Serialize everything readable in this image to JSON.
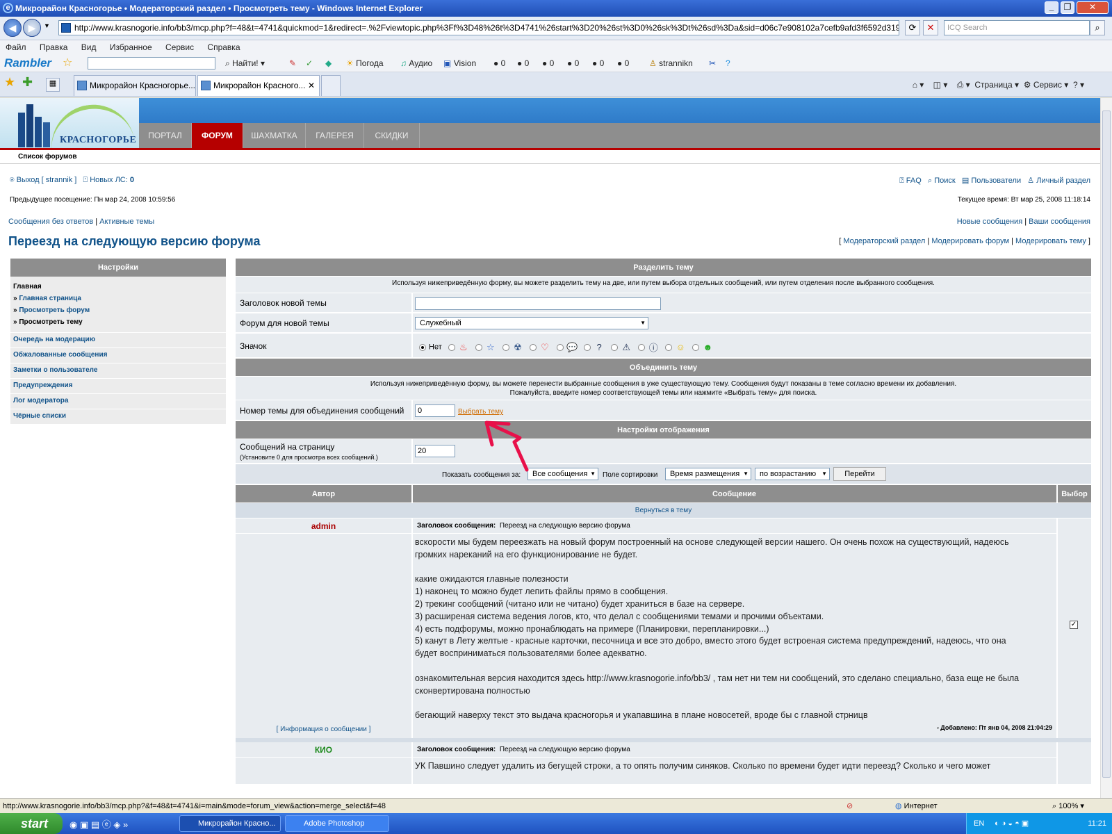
{
  "window": {
    "title": "Микрорайон Красногорье • Модераторский раздел • Просмотреть тему - Windows Internet Explorer"
  },
  "browser": {
    "address": "http://www.krasnogorie.info/bb3/mcp.php?f=48&t=4741&quickmod=1&redirect=.%2Fviewtopic.php%3Ff%3D48%26t%3D4741%26start%3D20%26st%3D0%26sk%3Dt%26sd%3Da&sid=d06c7e908102a7cefb9afd3f6592d319",
    "search_placeholder": "ICQ Search",
    "menu": [
      "Файл",
      "Правка",
      "Вид",
      "Избранное",
      "Сервис",
      "Справка"
    ],
    "rambler_logo": "Rambler",
    "rambler_find": "Найти!",
    "rambler_items": [
      "Погода",
      "Аудио",
      "Vision",
      "0",
      "0",
      "0",
      "0",
      "0",
      "0",
      "strannikn"
    ],
    "tabs": [
      "Микрорайон Красногорье...",
      "Микрорайон Красного..."
    ],
    "tools": [
      "Страница",
      "Сервис"
    ],
    "status_url": "http://www.krasnogorie.info/bb3/mcp.php?&f=48&t=4741&i=main&mode=forum_view&action=merge_select&f=48",
    "zone": "Интернет",
    "zoom": "100%"
  },
  "site": {
    "logo_text": "КРАСНОГОРЬЕ",
    "nav": [
      "ПОРТАЛ",
      "ФОРУМ",
      "ШАХМАТКА",
      "ГАЛЕРЕЯ",
      "СКИДКИ"
    ],
    "breadcrumb": "Список форумов",
    "logout": "Выход [ strannik ]",
    "new_pm_label": "Новых ЛС:",
    "new_pm_count": "0",
    "faq": "FAQ",
    "search": "Поиск",
    "members": "Пользователи",
    "ucp": "Личный раздел",
    "last_visit": "Предыдущее посещение: Пн мар 24, 2008 10:59:56",
    "current_time": "Текущее время: Вт мар 25, 2008 11:18:14",
    "unanswered": "Сообщения без ответов",
    "active": "Активные темы",
    "new_posts": "Новые сообщения",
    "your_posts": "Ваши сообщения",
    "page_title": "Переезд на следующую версию форума",
    "mod_links": [
      "Модераторский раздел",
      "Модерировать форум",
      "Модерировать тему"
    ]
  },
  "left": {
    "title": "Настройки",
    "main_label": "Главная",
    "sub": [
      "Главная страница",
      "Просмотреть форум",
      "Просмотреть тему"
    ],
    "items": [
      "Очередь на модерацию",
      "Обжалованные сообщения",
      "Заметки о пользователе",
      "Предупреждения",
      "Лог модератора",
      "Чёрные списки"
    ]
  },
  "split": {
    "title": "Разделить тему",
    "desc": "Используя нижеприведённую форму, вы можете разделить тему на две, или путем выбора отдельных сообщений, или путем отделения после выбранного сообщения.",
    "new_title_label": "Заголовок новой темы",
    "forum_label": "Форум для новой темы",
    "forum_value": "Служебный",
    "icon_label": "Значок",
    "icon_none": "Нет"
  },
  "merge": {
    "title": "Объединить тему",
    "desc1": "Используя нижеприведённую форму, вы можете перенести выбранные сообщения в уже существующую тему. Сообщения будут показаны в теме согласно времени их добавления.",
    "desc2": "Пожалуйста, введите номер соответствующей темы или нажмите «Выбрать тему» для поиска.",
    "label": "Номер темы для объединения сообщений",
    "value": "0",
    "select_link": "Выбрать тему"
  },
  "display": {
    "title": "Настройки отображения",
    "per_page_label": "Сообщений на страницу",
    "per_page_hint": "(Установите 0 для просмотра всех сообщений.)",
    "per_page_value": "20",
    "show_label": "Показать сообщения за:",
    "show_value": "Все сообщения",
    "sort_label": "Поле сортировки",
    "sort_value": "Время размещения",
    "order_value": "по возрастанию",
    "go": "Перейти"
  },
  "posts_table": {
    "col_author": "Автор",
    "col_message": "Сообщение",
    "col_select": "Выбор",
    "back": "Вернуться в тему",
    "subject_label": "Заголовок сообщения:",
    "posts": [
      {
        "author": "admin",
        "subject": "Переезд на следующую версию форума",
        "lines": [
          "вскорости мы будем переезжать на новый форум построенный на основе следующей версии нашего. Он очень похож на существующий, надеюсь громких нареканий на его функционирование не будет.",
          "",
          "какие ожидаются главные полезности",
          "1) наконец то можно будет лепить файлы прямо в сообщения.",
          "2) трекинг сообщений (читано или не читано) будет храниться в базе на сервере.",
          "3) расширеная система ведения логов, кто, что делал с сообщениями темами и прочими объектами.",
          "4) есть подфорумы, можно пронаблюдать на примере (Планировки, перепланировки...)",
          "5) канут в Лету желтые - красные карточки, песочница и все это добро, вместо этого будет встроеная система предупреждений, надеюсь, что она будет восприниматься пользователями более адекватно.",
          "",
          "ознакомительная версия находится здесь http://www.krasnogorie.info/bb3/ , там нет ни тем ни сообщений, это сделано специально, база еще не была сконвертирована полностью",
          "",
          "бегающий наверху текст это выдача красногорья и укапавшина в плане новосетей, вроде бы с главной стрницв"
        ],
        "info": "[ Информация о сообщении ]",
        "posted": "Добавлено: Пт янв 04, 2008 21:04:29"
      },
      {
        "author": "КИО",
        "subject": "Переезд на следующую версию форума",
        "lines": [
          "УК Павшино следует удалить из бегущей строки, а то опять получим синяков. Сколько по времени будет идти переезд? Сколько и чего может"
        ]
      }
    ]
  },
  "taskbar": {
    "start": "start",
    "tasks": [
      "Микрорайон Красно...",
      "Adobe Photoshop"
    ],
    "lang": "EN",
    "time": "11:21"
  },
  "colors": {
    "nav_active": "#b60000",
    "header_blue": "#2f7cd0",
    "panel_gray": "#8e8e8e",
    "link": "#105289",
    "arrow": "#e8104a"
  }
}
